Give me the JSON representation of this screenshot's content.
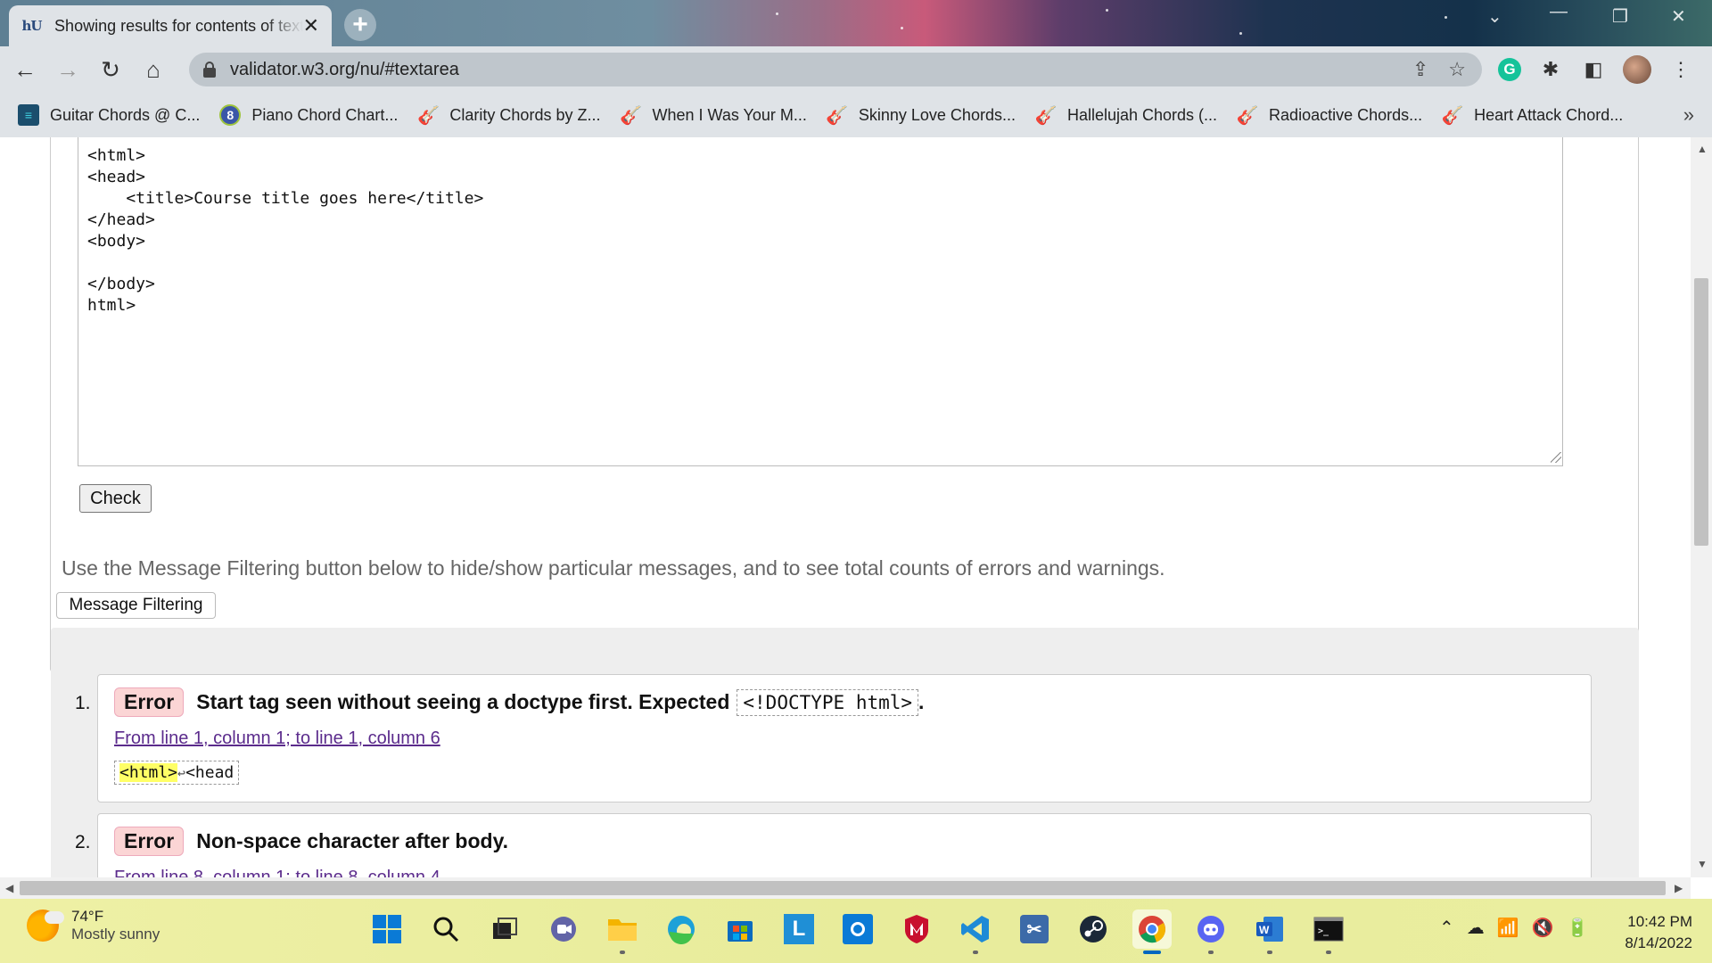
{
  "browser": {
    "tab_title": "Showing results for contents of text-input area",
    "url": "validator.w3.org/nu/#textarea"
  },
  "bookmarks": [
    {
      "label": "Guitar Chords @ C...",
      "icon": "guitar-chords-icon"
    },
    {
      "label": "Piano Chord Chart...",
      "icon": "piano-icon"
    },
    {
      "label": "Clarity Chords by Z...",
      "icon": "ultimate-guitar-icon"
    },
    {
      "label": "When I Was Your M...",
      "icon": "ultimate-guitar-icon"
    },
    {
      "label": "Skinny Love Chords...",
      "icon": "ultimate-guitar-icon"
    },
    {
      "label": "Hallelujah Chords (...",
      "icon": "ultimate-guitar-icon"
    },
    {
      "label": "Radioactive Chords...",
      "icon": "ultimate-guitar-icon"
    },
    {
      "label": "Heart Attack Chord...",
      "icon": "ultimate-guitar-icon"
    }
  ],
  "bookmarks_more": "»",
  "editor": {
    "code": "<html>\n<head>\n    <title>Course title goes here</title>\n</head>\n<body>\n\n</body>\nhtml>"
  },
  "check_label": "Check",
  "filter_hint": "Use the Message Filtering button below to hide/show particular messages, and to see total counts of errors and warnings.",
  "filter_button": "Message Filtering",
  "messages": [
    {
      "num": "1.",
      "type": "Error",
      "text": "Start tag seen without seeing a doctype first. Expected",
      "code": "<!DOCTYPE html>",
      "trail": ".",
      "location": "From line 1, column 1; to line 1, column 6",
      "extract_hl": "<html>",
      "extract_ret": "↩",
      "extract_rest": "<head"
    },
    {
      "num": "2.",
      "type": "Error",
      "text": "Non-space character after body.",
      "location": "From line 8, column 1; to line 8, column 4"
    }
  ],
  "taskbar": {
    "temp": "74°F",
    "condition": "Mostly sunny",
    "time": "10:42 PM",
    "date": "8/14/2022"
  },
  "colors": {
    "error_badge": "#fbd5d5",
    "link": "#5b2b8c",
    "highlight": "#ffff66"
  }
}
